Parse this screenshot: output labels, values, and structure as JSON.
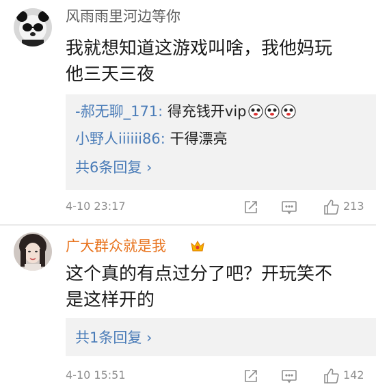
{
  "comments": [
    {
      "username": "风雨雨里河边等你",
      "text_line1": "我就想知道这游戏叫啥，我他妈玩",
      "text_line2": "他三天三夜",
      "replies": [
        {
          "name": "-郝无聊_171:",
          "text": " 得充钱开vip"
        },
        {
          "name": "小野人iiiiii86:",
          "text": " 干得漂亮"
        }
      ],
      "more_replies": "共6条回复 ›",
      "time": "4-10 23:17",
      "likes": "213"
    },
    {
      "username": "广大群众就是我",
      "text_line1": "这个真的有点过分了吧？开玩笑不",
      "text_line2": "是这样开的",
      "replies": [],
      "more_replies": "共1条回复 ›",
      "time": "4-10 15:51",
      "likes": "142"
    }
  ],
  "icons": {
    "share": "share-icon",
    "reply": "comment-icon",
    "like": "thumbs-up-icon",
    "crown": "crown-badge-icon",
    "emoji": "panda-emoji-icon"
  },
  "colors": {
    "link_blue": "#4a7cb8",
    "vip_orange": "#e8741f",
    "meta_gray": "#8e8e8e",
    "reply_bg": "#f2f2f2"
  }
}
